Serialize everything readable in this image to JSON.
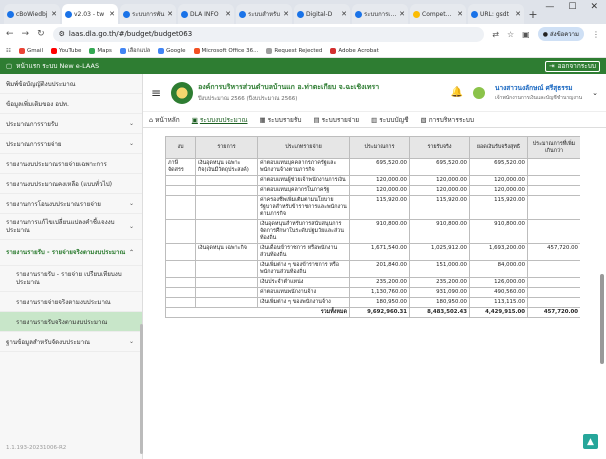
{
  "browser": {
    "tabs": [
      {
        "title": "cBoWiedbj",
        "color": "#1a73e8",
        "active": false
      },
      {
        "title": "v2.03 - tw",
        "color": "#1a73e8",
        "active": true
      },
      {
        "title": "ระบบการพัน",
        "color": "#1a73e8",
        "active": false
      },
      {
        "title": "DLA INFO",
        "color": "#1a73e8",
        "active": false
      },
      {
        "title": "ระบบสำหรับ",
        "color": "#1a73e8",
        "active": false
      },
      {
        "title": "Digital-D",
        "color": "#1a73e8",
        "active": false
      },
      {
        "title": "ระบบการเงิน",
        "color": "#1a73e8",
        "active": false
      },
      {
        "title": "Competency",
        "color": "#fbbc04",
        "active": false
      },
      {
        "title": "URL: gsdt",
        "color": "#1a73e8",
        "active": false
      }
    ],
    "url": "laas.dla.go.th/#/budget/budget063",
    "profile_label": "ส่งข้อความ",
    "bookmarks": [
      {
        "label": "Gmail",
        "color": "#ea4335"
      },
      {
        "label": "YouTube",
        "color": "#ff0000"
      },
      {
        "label": "Maps",
        "color": "#34a853"
      },
      {
        "label": "เลือกแปล",
        "color": "#4285f4"
      },
      {
        "label": "Google",
        "color": "#4285f4"
      },
      {
        "label": "Microsoft Office 36...",
        "color": "#f25022"
      },
      {
        "label": "Request Rejected",
        "color": "#9e9e9e"
      },
      {
        "label": "Adobe Acrobat",
        "color": "#d32f2f"
      }
    ]
  },
  "appbar": {
    "title": "หน้าแรก ระบบ New e-LAAS",
    "right_label": "ออกจากระบบ"
  },
  "sidebar": {
    "items": [
      {
        "label": "พิมพ์ข้อบัญญัติงบประมาณ",
        "chev": false,
        "type": "normal"
      },
      {
        "label": "ข้อมูลเพิ่มเติมของ อปท.",
        "chev": false,
        "type": "normal"
      },
      {
        "label": "ประมาณการรายรับ",
        "chev": true,
        "type": "normal"
      },
      {
        "label": "ประมาณการรายจ่าย",
        "chev": true,
        "type": "normal"
      },
      {
        "label": "รายงานงบประมาณรายจ่ายเฉพาะการ",
        "chev": false,
        "type": "normal"
      },
      {
        "label": "รายงานงบประมาณคงเหลือ (แบบทั่วไป)",
        "chev": false,
        "type": "normal"
      },
      {
        "label": "รายงานการโอนงบประมาณรายจ่าย",
        "chev": true,
        "type": "normal"
      },
      {
        "label": "รายงานการแก้ไขเปลี่ยนแปลงคำชี้แจงงบประมาณ",
        "chev": true,
        "type": "tall"
      },
      {
        "label": "รายงานรายรับ - รายจ่ายจริงตามงบประมาณ",
        "chev": true,
        "type": "tall-parent"
      },
      {
        "label": "รายงานรายรับ - รายจ่าย เปรียบเทียบงบประมาณ",
        "chev": false,
        "type": "tall-sub"
      },
      {
        "label": "รายงานรายจ่ายจริงตามงบประมาณ",
        "chev": false,
        "type": "sub"
      },
      {
        "label": "รายงานรายรับจริงตามงบประมาณ",
        "chev": false,
        "type": "sub-sel"
      },
      {
        "label": "ฐานข้อมูลสำหรับจัดงบประมาณ",
        "chev": true,
        "type": "normal"
      }
    ],
    "version": "1.1.193-20231006-R2"
  },
  "header": {
    "org_name": "องค์การบริหารส่วนตำบลบ้านแก อ.ท่าตะเกียบ จ.ฉะเชิงเทรา",
    "org_sub": "ปีงบประมาณ 2566 (ปีงบประมาณ 2566)",
    "user_name": "นางสาวนงลักษณ์ ศรีสุธรรม",
    "user_role": "เจ้าพนักงานการเงินและบัญชีชำนาญงาน"
  },
  "menu": [
    {
      "label": "หน้าหลัก",
      "icon": "⌂",
      "active": false
    },
    {
      "label": "ระบบงบประมาณ",
      "icon": "▣",
      "active": true
    },
    {
      "label": "ระบบรายรับ",
      "icon": "▦",
      "active": false
    },
    {
      "label": "ระบบรายจ่าย",
      "icon": "▤",
      "active": false
    },
    {
      "label": "ระบบบัญชี",
      "icon": "▥",
      "active": false
    },
    {
      "label": "การบริหารระบบ",
      "icon": "▧",
      "active": false
    }
  ],
  "table": {
    "headers": [
      "งบ",
      "รายการ",
      "ประเภทรายจ่าย",
      "ประมาณการ",
      "รายรับจริง",
      "ยอดเงินรับจริงสุทธิ",
      "ประมาณการที่เพิ่มเกินกว่า"
    ],
    "rows": [
      {
        "cat": "ภาษีจัดสรร",
        "sub": "เงินอุดหนุน เฉพาะกิจ(เงินมีวัตถุประสงค์)",
        "desc": "ค่าตอบแทนบุคคลากรภาครัฐและพนักงานจ้างตามภารกิจ",
        "est": "695,520.00",
        "act": "695,520.00",
        "net": "695,520.00",
        "over": ""
      },
      {
        "cat": "",
        "sub": "",
        "desc": "ค่าตอบแทนผู้ช่วยเจ้าพนักงานการเงิน",
        "est": "120,000.00",
        "act": "120,000.00",
        "net": "120,000.00",
        "over": ""
      },
      {
        "cat": "",
        "sub": "",
        "desc": "ค่าตอบแทนบุคลากรในภาครัฐ",
        "est": "120,000.00",
        "act": "120,000.00",
        "net": "120,000.00",
        "over": ""
      },
      {
        "cat": "",
        "sub": "",
        "desc": "ค่าครองชีพเพิ่มเติมตามนโยบายรัฐบาลสำหรับข้าราชการและพนักงานตามภารกิจ",
        "est": "115,920.00",
        "act": "115,920.00",
        "net": "115,920.00",
        "over": ""
      },
      {
        "cat": "",
        "sub": "",
        "desc": "เงินอุดหนุนสำหรับการสนับสนุนการจัดการศึกษาในระดับปฐมวัยและส่วนท้องถิ่น",
        "est": "910,800.00",
        "act": "910,800.00",
        "net": "910,800.00",
        "over": ""
      },
      {
        "cat": "",
        "sub": "เงินอุดหนุน เฉพาะกิจ",
        "desc": "เงินเดือนข้าราชการ หรือพนักงานส่วนท้องถิ่น",
        "est": "1,671,540.00",
        "act": "1,025,912.00",
        "net": "1,693,200.00",
        "over": "457,720.00"
      },
      {
        "cat": "",
        "sub": "",
        "desc": "เงินเพิ่มต่าง ๆ ของข้าราชการ หรือพนักงานส่วนท้องถิ่น",
        "est": "201,840.00",
        "act": "151,000.00",
        "net": "84,000.00",
        "over": ""
      },
      {
        "cat": "",
        "sub": "",
        "desc": "เงินประจำตำแหน่ง",
        "est": "235,200.00",
        "act": "235,200.00",
        "net": "126,000.00",
        "over": ""
      },
      {
        "cat": "",
        "sub": "",
        "desc": "ค่าตอบแทนพนักงานจ้าง",
        "est": "1,130,760.00",
        "act": "931,090.00",
        "net": "490,560.00",
        "over": ""
      },
      {
        "cat": "",
        "sub": "",
        "desc": "เงินเพิ่มต่าง ๆ ของพนักงานจ้าง",
        "est": "180,950.00",
        "act": "180,950.00",
        "net": "113,115.00",
        "over": ""
      }
    ],
    "total": {
      "label": "รวมทั้งหมด",
      "est": "9,692,960.31",
      "act": "8,483,502.43",
      "net": "4,429,915.00",
      "over": "457,720.00"
    }
  }
}
